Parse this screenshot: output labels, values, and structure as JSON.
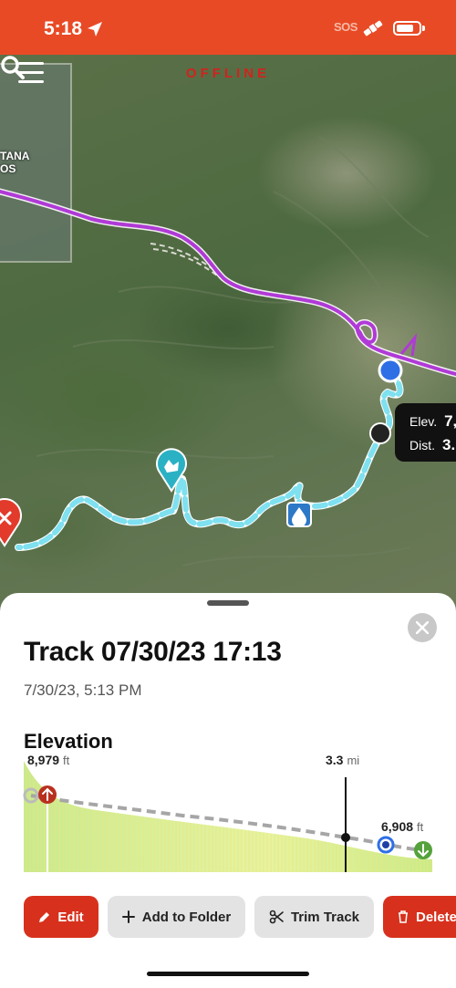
{
  "status_bar": {
    "time": "5:18",
    "sos": "SOS",
    "battery_level": 0.8,
    "background_color": "#e84a25"
  },
  "map": {
    "mode_label": "OFFLINE",
    "area_label_line1": "TANA",
    "area_label_line2": "OS",
    "readout": {
      "elev_label": "Elev.",
      "elev_value": "7,",
      "dist_label": "Dist.",
      "dist_value": "3."
    },
    "icons": [
      "menu-icon",
      "search-icon",
      "waypoint-elk-icon",
      "water-icon",
      "start-marker-icon"
    ],
    "track_color": "#7fe0ef",
    "route_color": "#b03ad6"
  },
  "sheet": {
    "title": "Track 07/30/23 17:13",
    "date": "7/30/23, 5:13 PM",
    "elevation_heading": "Elevation",
    "chart": {
      "start_elev_value": "8,979",
      "start_elev_unit": "ft",
      "cursor_dist_value": "3.3",
      "cursor_dist_unit": "mi",
      "end_elev_value": "6,908",
      "end_elev_unit": "ft"
    },
    "actions": {
      "edit": "Edit",
      "add_to_folder": "Add to Folder",
      "trim_track": "Trim Track",
      "delete": "Delete"
    }
  }
}
